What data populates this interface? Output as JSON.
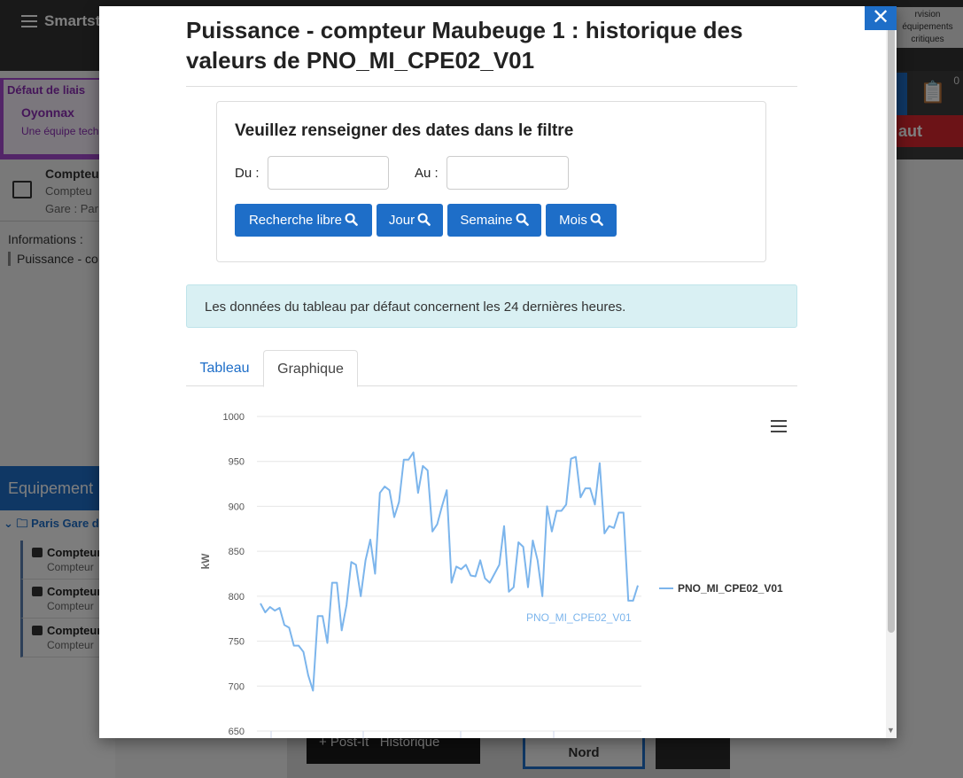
{
  "app": {
    "brand": "Smartsta",
    "top_right_label": "rvision équipements critiques",
    "alert": {
      "title": "Défaut de liais",
      "station": "Oyonnax",
      "subtitle": "Une équipe tech"
    },
    "clipboard_count": "0",
    "red_label": "aut",
    "compteur": {
      "title": "Compteu",
      "subtitle": "Compteu",
      "gare": "Gare : Par"
    },
    "infos_label": "Informations :",
    "infos_item": "Puissance - co",
    "equip_header": "Equipement",
    "tree_root": "Paris Gare d",
    "equip_items": [
      {
        "title": "Compteur",
        "subtitle": "Compteur"
      },
      {
        "title": "Compteur",
        "subtitle": "Compteur"
      },
      {
        "title": "Compteur",
        "subtitle": "Compteur"
      }
    ],
    "bottom_postit": "+ Post-It",
    "bottom_historique": "Historique",
    "bottom_nord": "Nord"
  },
  "modal": {
    "title": "Puissance - compteur Maubeuge 1 : historique des valeurs de PNO_MI_CPE02_V01",
    "close_glyph": "✕",
    "filter": {
      "heading": "Veuillez renseigner des dates dans le filtre",
      "from_label": "Du :",
      "to_label": "Au :",
      "from_value": "",
      "to_value": "",
      "buttons": [
        "Recherche libre",
        "Jour",
        "Semaine",
        "Mois"
      ]
    },
    "info": "Les données du tableau par défaut concernent les 24 dernières heures.",
    "tabs": [
      "Tableau",
      "Graphique"
    ],
    "active_tab": "Graphique"
  },
  "chart_data": {
    "type": "line",
    "ylabel": "kW",
    "ylim": [
      650,
      1000
    ],
    "yticks": [
      650,
      700,
      750,
      800,
      850,
      900,
      950,
      1000
    ],
    "grid": true,
    "legend_position": "right",
    "series": [
      {
        "name": "PNO_MI_CPE02_V01",
        "color": "#7cb5ec",
        "values": [
          792,
          782,
          788,
          784,
          787,
          768,
          765,
          745,
          745,
          738,
          712,
          695,
          778,
          778,
          748,
          815,
          815,
          762,
          790,
          838,
          835,
          800,
          840,
          863,
          825,
          915,
          922,
          918,
          888,
          905,
          952,
          952,
          960,
          915,
          945,
          940,
          872,
          880,
          900,
          918,
          815,
          833,
          830,
          835,
          823,
          822,
          840,
          820,
          815,
          825,
          835,
          878,
          805,
          810,
          860,
          855,
          810,
          862,
          840,
          800,
          900,
          872,
          895,
          895,
          902,
          953,
          955,
          910,
          920,
          920,
          902,
          948,
          870,
          878,
          876,
          893,
          893,
          795,
          795,
          812
        ],
        "end_label": "PNO_MI_CPE02_V01"
      }
    ]
  }
}
